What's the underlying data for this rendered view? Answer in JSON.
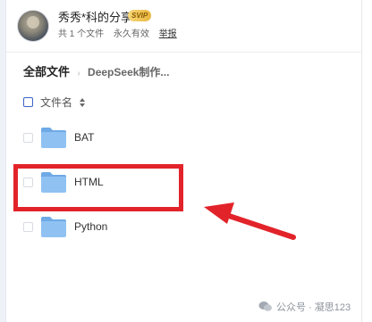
{
  "header": {
    "user_name": "秀秀*科的分享",
    "badge": "SVIP",
    "file_count": "共 1 个文件",
    "validity": "永久有效",
    "report": "举报"
  },
  "breadcrumb": {
    "root": "全部文件",
    "separator": "›",
    "current": "DeepSeek制作..."
  },
  "list": {
    "column_title": "文件名",
    "rows": [
      {
        "label": "BAT",
        "icon": "folder-icon"
      },
      {
        "label": "HTML",
        "icon": "folder-icon"
      },
      {
        "label": "Python",
        "icon": "folder-icon"
      }
    ]
  },
  "annotation": {
    "highlight_color": "#e2232a"
  },
  "watermark": {
    "text": "公众号 · 凝思123"
  },
  "colors": {
    "folder": "#8fc2f2",
    "folder_tab": "#6fa9e6",
    "checkbox_active": "#3d63c8"
  }
}
